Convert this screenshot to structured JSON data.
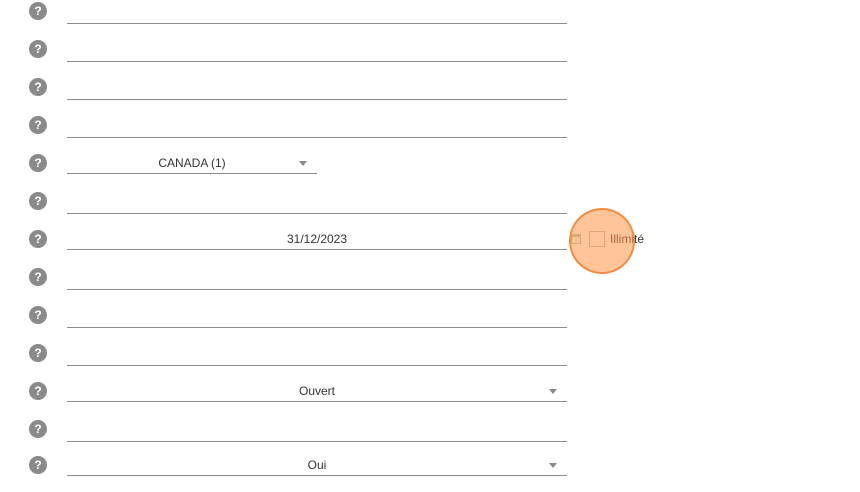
{
  "help_icon_glyph": "?",
  "fields": [
    {
      "value": ""
    },
    {
      "value": ""
    },
    {
      "value": ""
    },
    {
      "value": ""
    },
    {
      "value": "CANADA (1)",
      "type": "dropdown"
    },
    {
      "value": ""
    },
    {
      "value": "31/12/2023",
      "type": "date"
    },
    {
      "value": ""
    },
    {
      "value": ""
    },
    {
      "value": ""
    },
    {
      "value": "Ouvert",
      "type": "dropdown"
    },
    {
      "value": ""
    },
    {
      "value": "Oui",
      "type": "dropdown"
    }
  ],
  "unlimited": {
    "label": "Illimité",
    "checked": false
  },
  "colors": {
    "help_icon": "#8a8a8a",
    "underline": "#8c8c8c",
    "click_marker": "#f7a15a"
  }
}
